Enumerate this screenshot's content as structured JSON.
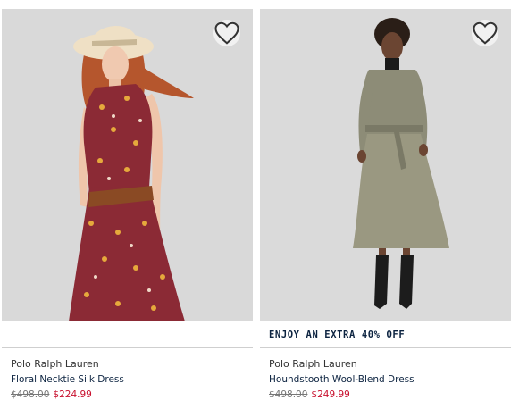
{
  "products": [
    {
      "brand": "Polo Ralph Lauren",
      "name": "Floral Necktie Silk Dress",
      "original_price": "$498.00",
      "sale_price": "$224.99",
      "promo": "",
      "image_alt": "Floral Necktie Silk Dress",
      "wishlist_icon": "heart-outline-icon"
    },
    {
      "brand": "Polo Ralph Lauren",
      "name": "Houndstooth Wool-Blend Dress",
      "original_price": "$498.00",
      "sale_price": "$249.99",
      "promo": "ENJOY AN EXTRA 40% OFF",
      "image_alt": "Houndstooth Wool-Blend Dress",
      "wishlist_icon": "heart-outline-icon"
    }
  ],
  "colors": {
    "image_background": "#d8d8d8",
    "brand_navy": "#0c2340",
    "sale_red": "#c8102e",
    "strike_gray": "#777777"
  }
}
